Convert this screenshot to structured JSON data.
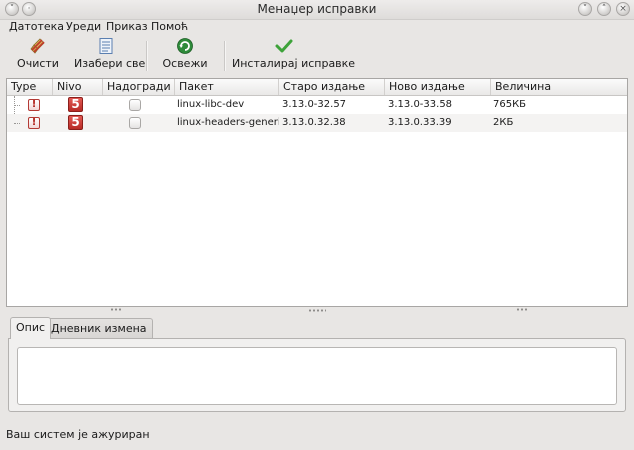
{
  "window": {
    "title": "Менаџер исправки"
  },
  "menu": [
    "Датотека",
    "Уреди",
    "Приказ",
    "Помоћ"
  ],
  "toolbar": {
    "clear_label": "Очисти",
    "select_all_label": "Изабери све",
    "refresh_label": "Освежи",
    "install_label": "Инсталирај исправке"
  },
  "columns": {
    "type": "Type",
    "level": "Nivo",
    "upgrade": "Надогради",
    "package": "Пакет",
    "old_version": "Старо издање",
    "new_version": "Ново издање",
    "size": "Величина"
  },
  "packages": [
    {
      "type_icon": "!",
      "level": "5",
      "upgrade": false,
      "name": "linux-libc-dev",
      "old_version": "3.13.0-32.57",
      "new_version": "3.13.0-33.58",
      "size": "765КБ"
    },
    {
      "type_icon": "!",
      "level": "5",
      "upgrade": false,
      "name": "linux-headers-generic",
      "old_version": "3.13.0.32.38",
      "new_version": "3.13.0.33.39",
      "size": "2КБ"
    }
  ],
  "tabs": [
    "Опис",
    "Дневник измена"
  ],
  "status": {
    "text": "Ваш систем је ажуриран"
  },
  "colors": {
    "level_badge": "#c7332e",
    "install_icon": "#3ea33a",
    "refresh_icon": "#2e8b3a"
  }
}
